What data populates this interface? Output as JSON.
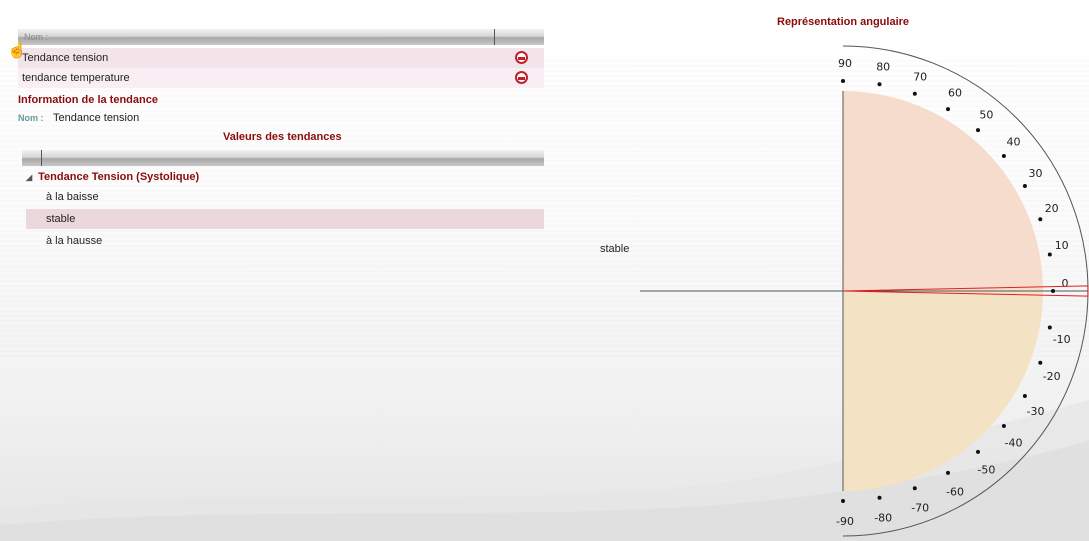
{
  "left_panel": {
    "list_header": "Nom :",
    "items": [
      {
        "label": "Tendance tension"
      },
      {
        "label": "tendance temperature"
      }
    ],
    "info_title": "Information de la tendance",
    "nom_label": "Nom :",
    "nom_value": "Tendance tension",
    "values_title": "Valeurs des tendances",
    "tree": {
      "group": "Tendance Tension (Systolique)",
      "items": [
        "à la baisse",
        "stable",
        "à la hausse"
      ],
      "selected": "stable"
    }
  },
  "state_label": "stable",
  "chart": {
    "title": "Représentation angulaire",
    "tick_labels": [
      "90",
      "80",
      "70",
      "60",
      "50",
      "40",
      "30",
      "20",
      "10",
      "0",
      "-10",
      "-20",
      "-30",
      "-40",
      "-50",
      "-60",
      "-70",
      "-80",
      "-90"
    ],
    "indicator_angle": 0,
    "colors": {
      "upper_fill": "#f5dccc",
      "lower_fill": "#f4e2c4",
      "indicator": "#e02020",
      "title": "#8b0c0c"
    }
  }
}
